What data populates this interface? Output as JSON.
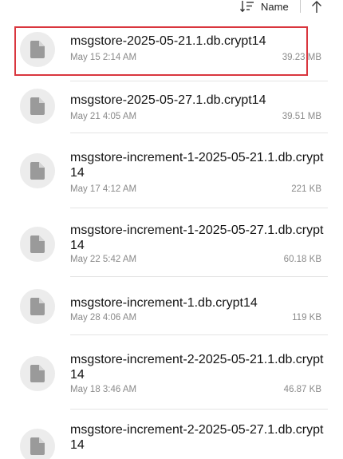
{
  "sort": {
    "label": "Name",
    "sort_icon": "sort-lines-icon",
    "direction_icon": "arrow-up-icon"
  },
  "files": [
    {
      "name": "msgstore-2025-05-21.1.db.crypt14",
      "date": "May 15 2:14 AM",
      "size": "39.23 MB",
      "selected": true
    },
    {
      "name": "msgstore-2025-05-27.1.db.crypt14",
      "date": "May 21 4:05 AM",
      "size": "39.51 MB"
    },
    {
      "name": "msgstore-increment-1-2025-05-21.1.db.crypt14",
      "date": "May 17 4:12 AM",
      "size": "221 KB"
    },
    {
      "name": "msgstore-increment-1-2025-05-27.1.db.crypt14",
      "date": "May 22 5:42 AM",
      "size": "60.18 KB"
    },
    {
      "name": "msgstore-increment-1.db.crypt14",
      "date": "May 28 4:06 AM",
      "size": "119 KB"
    },
    {
      "name": "msgstore-increment-2-2025-05-21.1.db.crypt14",
      "date": "May 18 3:46 AM",
      "size": "46.87 KB"
    },
    {
      "name": "msgstore-increment-2-2025-05-27.1.db.crypt14",
      "date": "",
      "size": ""
    }
  ],
  "colors": {
    "highlight": "#d9363e",
    "icon_bg": "#ececec",
    "icon_fg": "#9a9a9a"
  }
}
